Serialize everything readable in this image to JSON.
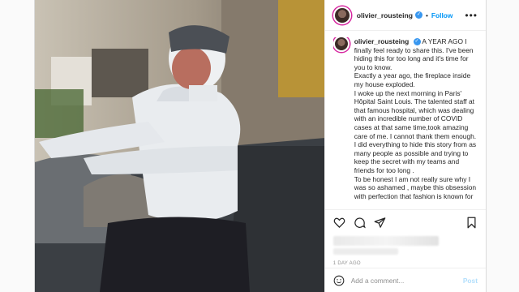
{
  "post": {
    "username": "olivier_rousteing",
    "follow_label": "Follow",
    "caption_title": "A YEAR AGO",
    "caption_paragraphs": [
      "I finally feel ready to share this. I've been hiding this for too long and it's time for you to know.",
      "Exactly a year ago, the fireplace inside my house exploded.",
      "I woke up the next morning in Paris' Hôpital Saint Louis. The talented staff at that famous hospital, which was dealing with an incredible number of COVID cases at that same time,took amazing care of me. I cannot thank them enough.",
      "I did everything to hide this story from as many people as possible and trying to keep the secret with my teams and friends for too long .",
      "To be honest I am not really sure why I was so ashamed , maybe this obsession with perfection that fashion is known for"
    ],
    "timestamp": "1 DAY AGO",
    "comment_placeholder": "Add a comment...",
    "post_button": "Post"
  },
  "icons": {
    "more": "more-options-icon",
    "like": "heart-icon",
    "comment": "comment-icon",
    "share": "share-icon",
    "save": "bookmark-icon",
    "emoji": "emoji-icon",
    "verified": "verified-badge-icon"
  },
  "colors": {
    "accent": "#0095f6",
    "verified": "#3897f0",
    "story_ring": "#d6249f"
  }
}
